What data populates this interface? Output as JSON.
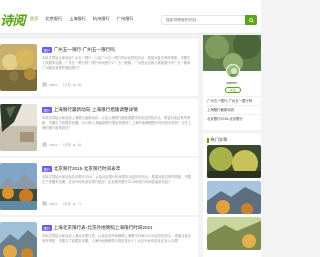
{
  "site": {
    "logo_text": "诗阅"
  },
  "nav": {
    "items": [
      "首页",
      "北京限行",
      "上海限行",
      "杭州限行",
      "广州限行"
    ]
  },
  "search": {
    "placeholder": "搜索你想要的内容"
  },
  "articles": [
    {
      "tag": "限行",
      "title": "广州五一限行-广州五一限行吗",
      "excerpt": "本篇文章给大家谈谈广州五一限行，以及广州五一限行吗对应的知识点，希望对各位有所帮助，不要忘了收藏本站喔。广东五一限行吗？限行时间是什么？五一假期，广州西北边那几条路限行吗？五一期间广州都会有哪些路段限行？",
      "author": "admin",
      "date": "1天前",
      "views": "58"
    },
    {
      "tag": "限行",
      "title": "上海限行最新动向-上海限行措施调整详情",
      "excerpt": "本篇文章给大家谈谈上海限行最新动向，以及上海限行措施调整详情对应的知识点，希望对各位有所帮助，不要忘了收藏本站喔。2023年上海最新限行规定有哪些？上海外地牌照限行时间是怎样的？今天上海的限行政策如何？",
      "author": "admin",
      "date": "1天前",
      "views": "64"
    },
    {
      "tag": "限行",
      "title": "北京限行2015-北京限行时间表年",
      "excerpt": "本篇文章给大家谈谈北京限行2015，以及北京限行时间表年对应的知识点，希望对各位有所帮助，不要忘了收藏本站喔。北京外地车进京限行规定？北京尾号限行2015年限行时间表最新消息？",
      "author": "admin",
      "date": "2天前",
      "views": "71"
    },
    {
      "tag": "限行",
      "title": "上海北京限行表-北京外地牌照上海限行时间2021",
      "excerpt": "本篇文章给大家谈谈上海北京限行表，以及北京外地牌照上海限行时间2021对应的知识点，希望对各位有所帮助，不要忘了收藏本站喔。上海外地牌照限行规定是什么？北京外地车进京证怎么办理？",
      "author": "admin",
      "date": "2天前",
      "views": "49"
    }
  ],
  "sidebar": {
    "author_name": "admin",
    "follow_label": "关注",
    "links": [
      "广州五一限行-广州五一限行吗",
      "上海限行最新动向",
      "北京限行2015-北京限行"
    ],
    "hot_title": "热门文章"
  }
}
